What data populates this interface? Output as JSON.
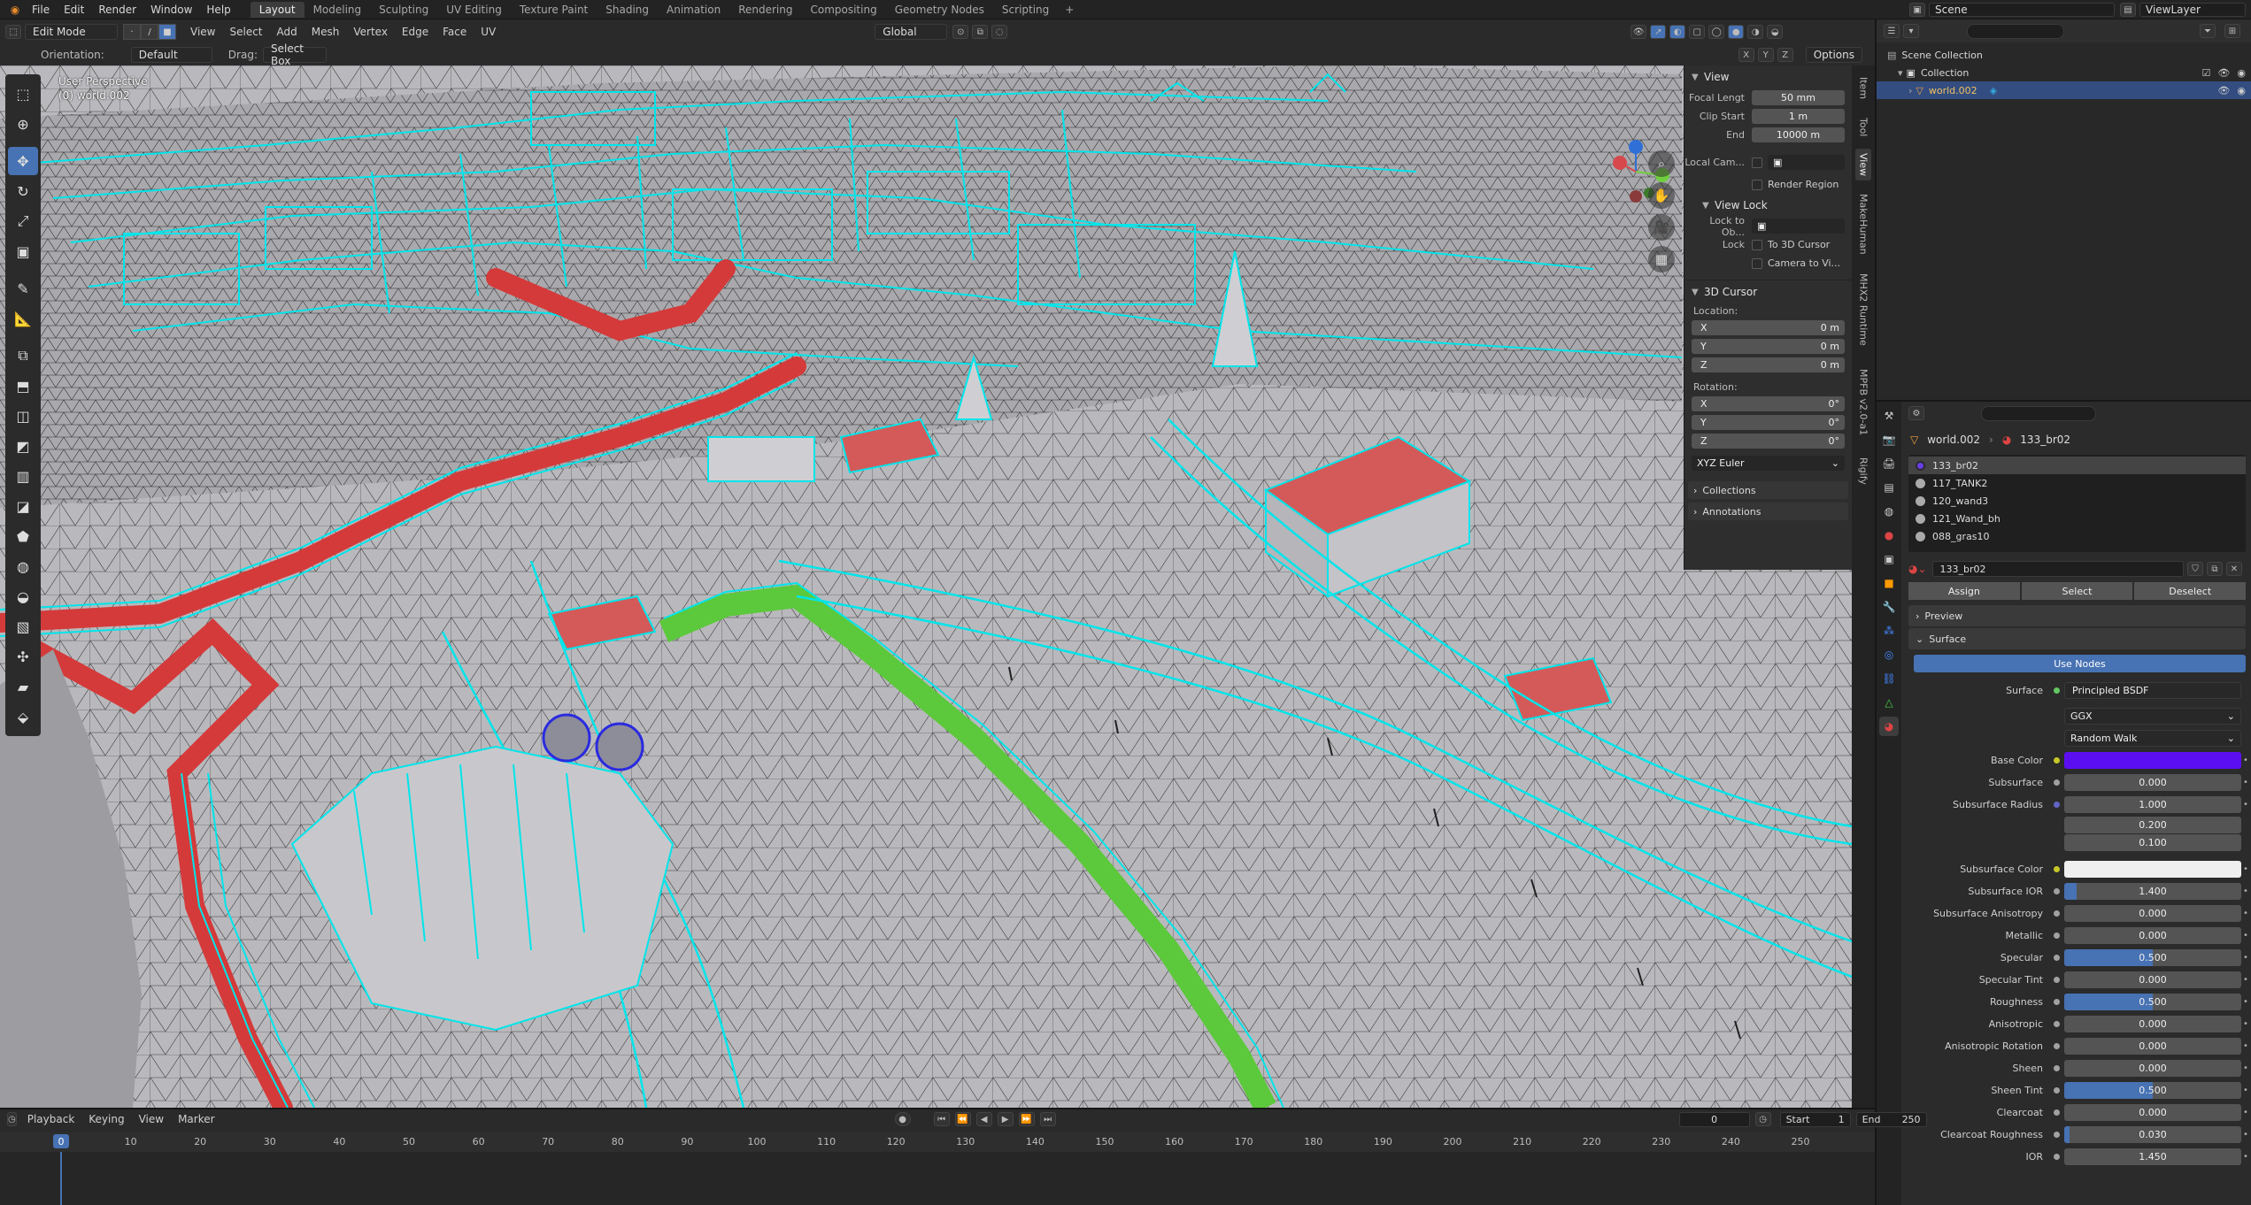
{
  "menu": [
    "File",
    "Edit",
    "Render",
    "Window",
    "Help"
  ],
  "workspaces": [
    "Layout",
    "Modeling",
    "Sculpting",
    "UV Editing",
    "Texture Paint",
    "Shading",
    "Animation",
    "Rendering",
    "Compositing",
    "Geometry Nodes",
    "Scripting"
  ],
  "active_workspace": "Layout",
  "scene": "Scene",
  "view_layer": "ViewLayer",
  "viewport_header": {
    "mode": "Edit Mode",
    "menus": [
      "View",
      "Select",
      "Add",
      "Mesh",
      "Vertex",
      "Edge",
      "Face",
      "UV"
    ],
    "transform_orientation": "Global",
    "options_label": "Options",
    "orientation_label": "Orientation:",
    "orientation_value": "Default",
    "drag_label": "Drag:",
    "drag_value": "Select Box",
    "xyz": [
      "X",
      "Y",
      "Z"
    ]
  },
  "viewport": {
    "view_name": "User Perspective",
    "object_name": "(0) world.002"
  },
  "npanel": {
    "view_title": "View",
    "focal_label": "Focal Lengt",
    "focal_value": "50 mm",
    "clip_start_label": "Clip Start",
    "clip_start_value": "1 m",
    "end_label": "End",
    "end_value": "10000 m",
    "local_cam_label": "Local Cam...",
    "render_region": "Render Region",
    "view_lock_title": "View Lock",
    "lock_to_obj_label": "Lock to Ob...",
    "lock_label": "Lock",
    "to_3d_cursor": "To 3D Cursor",
    "camera_to_view": "Camera to Vi...",
    "cursor_title": "3D Cursor",
    "location_label": "Location:",
    "loc": [
      {
        "axis": "X",
        "value": "0 m"
      },
      {
        "axis": "Y",
        "value": "0 m"
      },
      {
        "axis": "Z",
        "value": "0 m"
      }
    ],
    "rotation_label": "Rotation:",
    "rot": [
      {
        "axis": "X",
        "value": "0°"
      },
      {
        "axis": "Y",
        "value": "0°"
      },
      {
        "axis": "Z",
        "value": "0°"
      }
    ],
    "rot_mode": "XYZ Euler",
    "collections": "Collections",
    "annotations": "Annotations"
  },
  "vertical_tabs": [
    "Item",
    "Tool",
    "View",
    "MakeHuman",
    "MHX2 Runtime",
    "MPFB v2.0-a1",
    "Rigify"
  ],
  "outliner": {
    "scene_collection": "Scene Collection",
    "collection": "Collection",
    "object": "world.002"
  },
  "properties": {
    "crumb_object": "world.002",
    "crumb_material": "133_br02",
    "materials": [
      "133_br02",
      "117_TANK2",
      "120_wand3",
      "121_Wand_bh",
      "088_gras10"
    ],
    "material_name": "133_br02",
    "assign": "Assign",
    "select": "Select",
    "deselect": "Deselect",
    "preview": "Preview",
    "surface_panel": "Surface",
    "use_nodes": "Use Nodes",
    "surface_label": "Surface",
    "surface_value": "Principled BSDF",
    "distribution": "GGX",
    "subsurface_method": "Random Walk",
    "base_color_label": "Base Color",
    "subsurface_label": "Subsurface",
    "subsurface_value": "0.000",
    "subsurface_radius_label": "Subsurface Radius",
    "subsurface_radius": [
      "1.000",
      "0.200",
      "0.100"
    ],
    "subsurface_color_label": "Subsurface Color",
    "rows": [
      {
        "label": "Subsurface IOR",
        "value": "1.400",
        "fill": 0.07
      },
      {
        "label": "Subsurface Anisotropy",
        "value": "0.000",
        "fill": 0
      },
      {
        "label": "Metallic",
        "value": "0.000",
        "fill": 0
      },
      {
        "label": "Specular",
        "value": "0.500",
        "fill": 0.5
      },
      {
        "label": "Specular Tint",
        "value": "0.000",
        "fill": 0
      },
      {
        "label": "Roughness",
        "value": "0.500",
        "fill": 0.5
      },
      {
        "label": "Anisotropic",
        "value": "0.000",
        "fill": 0
      },
      {
        "label": "Anisotropic Rotation",
        "value": "0.000",
        "fill": 0
      },
      {
        "label": "Sheen",
        "value": "0.000",
        "fill": 0
      },
      {
        "label": "Sheen Tint",
        "value": "0.500",
        "fill": 0.5
      },
      {
        "label": "Clearcoat",
        "value": "0.000",
        "fill": 0
      },
      {
        "label": "Clearcoat Roughness",
        "value": "0.030",
        "fill": 0.03
      },
      {
        "label": "IOR",
        "value": "1.450",
        "fill": 0
      }
    ],
    "base_color": "#5b0ff0"
  },
  "timeline": {
    "menus": [
      "Playback",
      "Keying",
      "View",
      "Marker"
    ],
    "current_frame": "0",
    "start_label": "Start",
    "start": "1",
    "end_label": "End",
    "end": "250",
    "ticks": [
      "0",
      "10",
      "20",
      "30",
      "40",
      "50",
      "60",
      "70",
      "80",
      "90",
      "100",
      "110",
      "120",
      "130",
      "140",
      "150",
      "160",
      "170",
      "180",
      "190",
      "200",
      "210",
      "220",
      "230",
      "240",
      "250"
    ]
  },
  "colors": {
    "accent": "#4772b3",
    "wire": "#00e5ea",
    "selected_face": "#d43a3a",
    "green_path": "#5cc83b"
  }
}
